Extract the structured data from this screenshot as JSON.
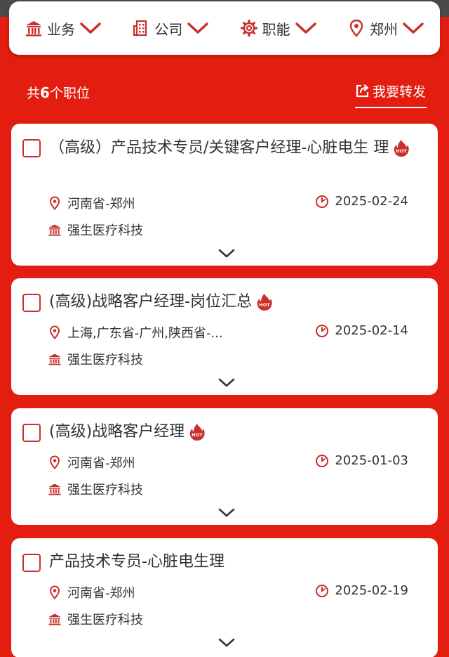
{
  "filters": [
    {
      "label": "业务",
      "icon": "bank-icon"
    },
    {
      "label": "公司",
      "icon": "building-icon"
    },
    {
      "label": "职能",
      "icon": "gear-icon"
    },
    {
      "label": "郑州",
      "icon": "location-pin-icon"
    }
  ],
  "summary": {
    "prefix": "共",
    "count": "6",
    "suffix": "个职位",
    "share_label": "我要转发"
  },
  "jobs": [
    {
      "title": "（高级）产品技术专员/关键客户经理-心脏电生理",
      "hot": true,
      "location": "河南省-郑州",
      "date": "2025-02-24",
      "company": "强生医疗科技"
    },
    {
      "title": "(高级)战略客户经理-岗位汇总",
      "hot": true,
      "location": "上海,广东省-广州,陕西省-...",
      "date": "2025-02-14",
      "company": "强生医疗科技"
    },
    {
      "title": "(高级)战略客户经理",
      "hot": true,
      "location": "河南省-郑州",
      "date": "2025-01-03",
      "company": "强生医疗科技"
    },
    {
      "title": "产品技术专员-心脏电生理",
      "hot": false,
      "location": "河南省-郑州",
      "date": "2025-02-19",
      "company": "强生医疗科技"
    }
  ],
  "hot_badge": "HOT",
  "colors": {
    "brand_red": "#e31e10",
    "icon_red": "#c9302c",
    "card_bg": "#ffffff",
    "text": "#333333"
  }
}
